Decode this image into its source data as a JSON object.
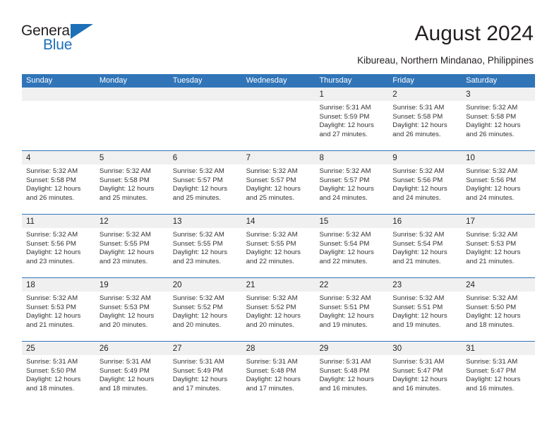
{
  "brand": {
    "name_part1": "General",
    "name_part2": "Blue",
    "triangle_icon": "blue-triangle-logo-mark",
    "accent_color": "#1d6fb8"
  },
  "header": {
    "title": "August 2024",
    "subtitle": "Kibureau, Northern Mindanao, Philippines"
  },
  "calendar": {
    "header_color": "#3175b8",
    "daynum_band_color": "#f0f0f0",
    "weekdays": [
      "Sunday",
      "Monday",
      "Tuesday",
      "Wednesday",
      "Thursday",
      "Friday",
      "Saturday"
    ],
    "weeks": [
      [
        {
          "day": "",
          "empty": true
        },
        {
          "day": "",
          "empty": true
        },
        {
          "day": "",
          "empty": true
        },
        {
          "day": "",
          "empty": true
        },
        {
          "day": "1",
          "sunrise": "Sunrise: 5:31 AM",
          "sunset": "Sunset: 5:59 PM",
          "daylight": "Daylight: 12 hours and 27 minutes."
        },
        {
          "day": "2",
          "sunrise": "Sunrise: 5:31 AM",
          "sunset": "Sunset: 5:58 PM",
          "daylight": "Daylight: 12 hours and 26 minutes."
        },
        {
          "day": "3",
          "sunrise": "Sunrise: 5:32 AM",
          "sunset": "Sunset: 5:58 PM",
          "daylight": "Daylight: 12 hours and 26 minutes."
        }
      ],
      [
        {
          "day": "4",
          "sunrise": "Sunrise: 5:32 AM",
          "sunset": "Sunset: 5:58 PM",
          "daylight": "Daylight: 12 hours and 26 minutes."
        },
        {
          "day": "5",
          "sunrise": "Sunrise: 5:32 AM",
          "sunset": "Sunset: 5:58 PM",
          "daylight": "Daylight: 12 hours and 25 minutes."
        },
        {
          "day": "6",
          "sunrise": "Sunrise: 5:32 AM",
          "sunset": "Sunset: 5:57 PM",
          "daylight": "Daylight: 12 hours and 25 minutes."
        },
        {
          "day": "7",
          "sunrise": "Sunrise: 5:32 AM",
          "sunset": "Sunset: 5:57 PM",
          "daylight": "Daylight: 12 hours and 25 minutes."
        },
        {
          "day": "8",
          "sunrise": "Sunrise: 5:32 AM",
          "sunset": "Sunset: 5:57 PM",
          "daylight": "Daylight: 12 hours and 24 minutes."
        },
        {
          "day": "9",
          "sunrise": "Sunrise: 5:32 AM",
          "sunset": "Sunset: 5:56 PM",
          "daylight": "Daylight: 12 hours and 24 minutes."
        },
        {
          "day": "10",
          "sunrise": "Sunrise: 5:32 AM",
          "sunset": "Sunset: 5:56 PM",
          "daylight": "Daylight: 12 hours and 24 minutes."
        }
      ],
      [
        {
          "day": "11",
          "sunrise": "Sunrise: 5:32 AM",
          "sunset": "Sunset: 5:56 PM",
          "daylight": "Daylight: 12 hours and 23 minutes."
        },
        {
          "day": "12",
          "sunrise": "Sunrise: 5:32 AM",
          "sunset": "Sunset: 5:55 PM",
          "daylight": "Daylight: 12 hours and 23 minutes."
        },
        {
          "day": "13",
          "sunrise": "Sunrise: 5:32 AM",
          "sunset": "Sunset: 5:55 PM",
          "daylight": "Daylight: 12 hours and 23 minutes."
        },
        {
          "day": "14",
          "sunrise": "Sunrise: 5:32 AM",
          "sunset": "Sunset: 5:55 PM",
          "daylight": "Daylight: 12 hours and 22 minutes."
        },
        {
          "day": "15",
          "sunrise": "Sunrise: 5:32 AM",
          "sunset": "Sunset: 5:54 PM",
          "daylight": "Daylight: 12 hours and 22 minutes."
        },
        {
          "day": "16",
          "sunrise": "Sunrise: 5:32 AM",
          "sunset": "Sunset: 5:54 PM",
          "daylight": "Daylight: 12 hours and 21 minutes."
        },
        {
          "day": "17",
          "sunrise": "Sunrise: 5:32 AM",
          "sunset": "Sunset: 5:53 PM",
          "daylight": "Daylight: 12 hours and 21 minutes."
        }
      ],
      [
        {
          "day": "18",
          "sunrise": "Sunrise: 5:32 AM",
          "sunset": "Sunset: 5:53 PM",
          "daylight": "Daylight: 12 hours and 21 minutes."
        },
        {
          "day": "19",
          "sunrise": "Sunrise: 5:32 AM",
          "sunset": "Sunset: 5:53 PM",
          "daylight": "Daylight: 12 hours and 20 minutes."
        },
        {
          "day": "20",
          "sunrise": "Sunrise: 5:32 AM",
          "sunset": "Sunset: 5:52 PM",
          "daylight": "Daylight: 12 hours and 20 minutes."
        },
        {
          "day": "21",
          "sunrise": "Sunrise: 5:32 AM",
          "sunset": "Sunset: 5:52 PM",
          "daylight": "Daylight: 12 hours and 20 minutes."
        },
        {
          "day": "22",
          "sunrise": "Sunrise: 5:32 AM",
          "sunset": "Sunset: 5:51 PM",
          "daylight": "Daylight: 12 hours and 19 minutes."
        },
        {
          "day": "23",
          "sunrise": "Sunrise: 5:32 AM",
          "sunset": "Sunset: 5:51 PM",
          "daylight": "Daylight: 12 hours and 19 minutes."
        },
        {
          "day": "24",
          "sunrise": "Sunrise: 5:32 AM",
          "sunset": "Sunset: 5:50 PM",
          "daylight": "Daylight: 12 hours and 18 minutes."
        }
      ],
      [
        {
          "day": "25",
          "sunrise": "Sunrise: 5:31 AM",
          "sunset": "Sunset: 5:50 PM",
          "daylight": "Daylight: 12 hours and 18 minutes."
        },
        {
          "day": "26",
          "sunrise": "Sunrise: 5:31 AM",
          "sunset": "Sunset: 5:49 PM",
          "daylight": "Daylight: 12 hours and 18 minutes."
        },
        {
          "day": "27",
          "sunrise": "Sunrise: 5:31 AM",
          "sunset": "Sunset: 5:49 PM",
          "daylight": "Daylight: 12 hours and 17 minutes."
        },
        {
          "day": "28",
          "sunrise": "Sunrise: 5:31 AM",
          "sunset": "Sunset: 5:48 PM",
          "daylight": "Daylight: 12 hours and 17 minutes."
        },
        {
          "day": "29",
          "sunrise": "Sunrise: 5:31 AM",
          "sunset": "Sunset: 5:48 PM",
          "daylight": "Daylight: 12 hours and 16 minutes."
        },
        {
          "day": "30",
          "sunrise": "Sunrise: 5:31 AM",
          "sunset": "Sunset: 5:47 PM",
          "daylight": "Daylight: 12 hours and 16 minutes."
        },
        {
          "day": "31",
          "sunrise": "Sunrise: 5:31 AM",
          "sunset": "Sunset: 5:47 PM",
          "daylight": "Daylight: 12 hours and 16 minutes."
        }
      ]
    ]
  }
}
